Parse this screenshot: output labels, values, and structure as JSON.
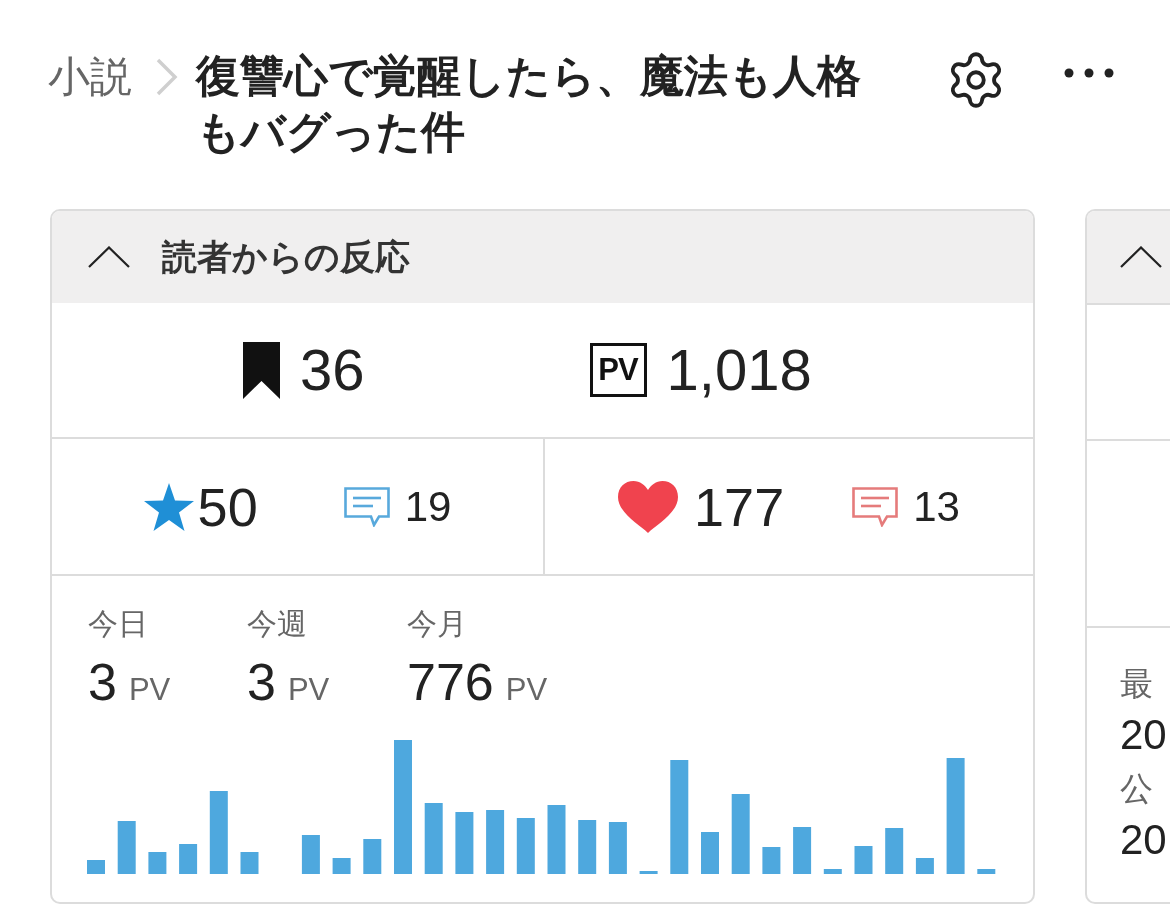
{
  "breadcrumb": {
    "section": "小説",
    "title": "復讐心で覚醒したら、魔法も人格もバグった件"
  },
  "reactions": {
    "title": "読者からの反応",
    "expanded": true,
    "totals": [
      {
        "kind": "bookmark",
        "value": "36"
      },
      {
        "kind": "pv",
        "badge": "PV",
        "value": "1,018"
      }
    ],
    "ratings": [
      {
        "kind": "star",
        "value": "50",
        "comments": "19"
      },
      {
        "kind": "heart",
        "value": "177",
        "comments": "13"
      }
    ],
    "periods": [
      {
        "label": "今日",
        "value": "3",
        "unit": "PV"
      },
      {
        "label": "今週",
        "value": "3",
        "unit": "PV"
      },
      {
        "label": "今月",
        "value": "776",
        "unit": "PV"
      }
    ]
  },
  "side_card": {
    "expanded": true,
    "fields": [
      {
        "label": "最",
        "value": "20"
      },
      {
        "label": "公",
        "value": "20"
      }
    ]
  }
}
